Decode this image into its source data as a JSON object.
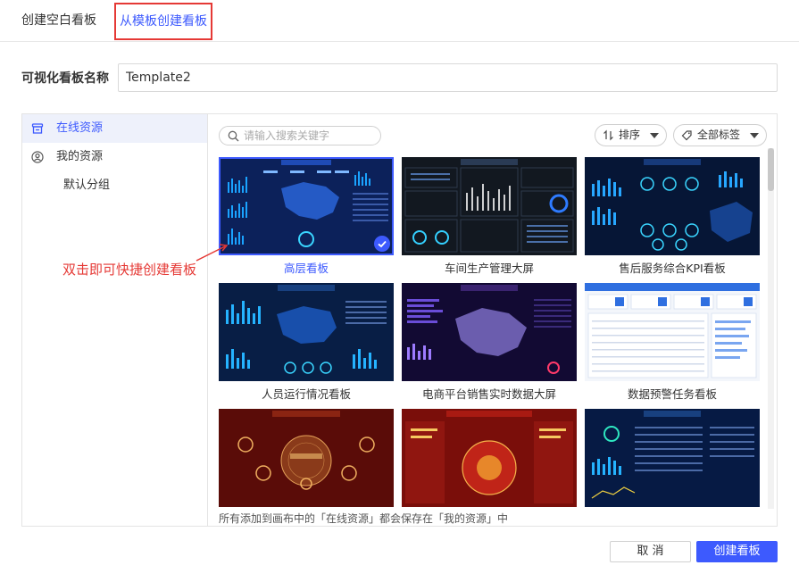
{
  "tabs": [
    {
      "label": "创建空白看板"
    },
    {
      "label": "从模板创建看板"
    }
  ],
  "name_field": {
    "label": "可视化看板名称",
    "value": "Template2"
  },
  "sidebar": {
    "items": [
      {
        "label": "在线资源"
      },
      {
        "label": "我的资源"
      },
      {
        "label": "默认分组"
      }
    ]
  },
  "search": {
    "placeholder": "请输入搜索关键字"
  },
  "sort": {
    "label": "排序"
  },
  "tags": {
    "label": "全部标签"
  },
  "templates": [
    {
      "caption": "高层看板"
    },
    {
      "caption": "车间生产管理大屏"
    },
    {
      "caption": "售后服务综合KPI看板"
    },
    {
      "caption": "人员运行情况看板"
    },
    {
      "caption": "电商平台销售实时数据大屏"
    },
    {
      "caption": "数据预警任务看板"
    },
    {
      "caption": ""
    },
    {
      "caption": ""
    },
    {
      "caption": ""
    }
  ],
  "footer_note": "所有添加到画布中的「在线资源」都会保存在「我的资源」中",
  "annotation": "双击即可快捷创建看板",
  "buttons": {
    "cancel": "取 消",
    "create": "创建看板"
  },
  "colors": {
    "accent": "#3d5afe",
    "annotation": "#e53935"
  }
}
